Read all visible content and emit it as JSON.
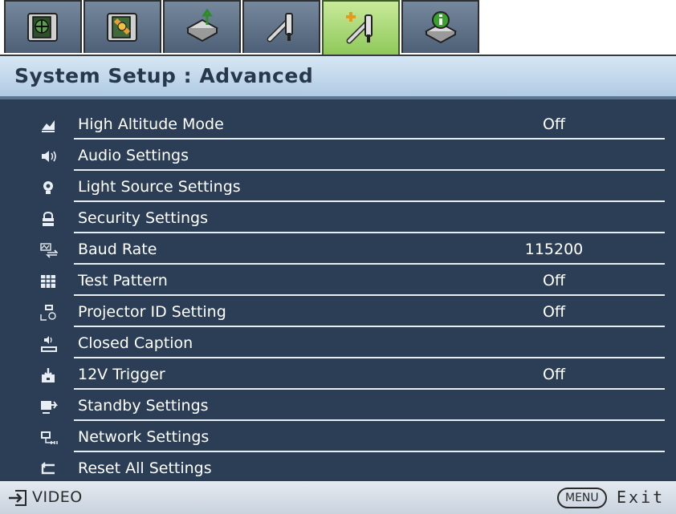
{
  "tabs": [
    {
      "icon": "picture-basic-icon"
    },
    {
      "icon": "picture-advanced-icon"
    },
    {
      "icon": "display-icon"
    },
    {
      "icon": "system-setup-basic-icon"
    },
    {
      "icon": "system-setup-advanced-icon",
      "active": true
    },
    {
      "icon": "information-icon"
    }
  ],
  "header": {
    "title": "System Setup : Advanced"
  },
  "menu": {
    "items": [
      {
        "icon": "altitude-icon",
        "label": "High Altitude Mode",
        "value": "Off"
      },
      {
        "icon": "speaker-icon",
        "label": "Audio Settings",
        "value": ""
      },
      {
        "icon": "lamp-icon",
        "label": "Light Source Settings",
        "value": ""
      },
      {
        "icon": "lock-icon",
        "label": "Security Settings",
        "value": ""
      },
      {
        "icon": "baud-rate-icon",
        "label": "Baud Rate",
        "value": "115200"
      },
      {
        "icon": "test-pattern-icon",
        "label": "Test Pattern",
        "value": "Off"
      },
      {
        "icon": "projector-id-icon",
        "label": "Projector ID Setting",
        "value": "Off"
      },
      {
        "icon": "closed-caption-icon",
        "label": "Closed Caption",
        "value": ""
      },
      {
        "icon": "trigger-icon",
        "label": "12V Trigger",
        "value": "Off"
      },
      {
        "icon": "standby-icon",
        "label": "Standby Settings",
        "value": ""
      },
      {
        "icon": "network-icon",
        "label": "Network Settings",
        "value": ""
      },
      {
        "icon": "reset-icon",
        "label": "Reset All Settings",
        "value": ""
      }
    ]
  },
  "status": {
    "source": "VIDEO",
    "menu_key": "MENU",
    "exit_label": "Exit"
  },
  "colors": {
    "background": "#2b3e56",
    "active_tab": "#a6d675",
    "title_bar": "#c4d9ec"
  }
}
